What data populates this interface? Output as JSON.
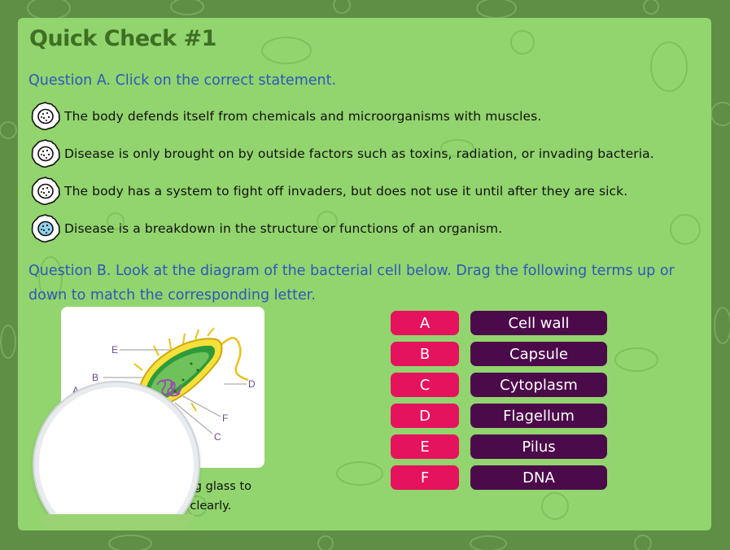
{
  "title": "Quick Check #1",
  "question_a": {
    "prompt": "Question A. Click on the correct statement.",
    "options": [
      {
        "text": "The body defends itself from chemicals and microorganisms with muscles.",
        "icon": "germ-icon"
      },
      {
        "text": "Disease is only brought on by outside factors such as toxins, radiation, or invading bacteria.",
        "icon": "germ-icon"
      },
      {
        "text": "The body has a system to fight off invaders, but does not use it until after they are sick.",
        "icon": "germ-icon"
      },
      {
        "text": "Disease is a breakdown in the structure or functions of an organism.",
        "icon": "germ-icon-selected"
      }
    ]
  },
  "question_b": {
    "prompt": "Question B. Look at the diagram of the bacterial cell below. Drag the following terms up or down to match the corresponding letter.",
    "diagram_labels": [
      "E",
      "B",
      "A",
      "D",
      "F",
      "C"
    ],
    "caption_line1": "ying glass to",
    "caption_line2": "view the labels clearly.",
    "letters": [
      "A",
      "B",
      "C",
      "D",
      "E",
      "F"
    ],
    "terms": [
      "Cell wall",
      "Capsule",
      "Cytoplasm",
      "Flagellum",
      "Pilus",
      "DNA"
    ]
  },
  "colors": {
    "background": "#5f8f45",
    "panel": "#92d46e",
    "title": "#3e6f23",
    "question": "#2e58b8",
    "letter_button": "#e5125e",
    "term_button": "#4b0a4a"
  }
}
